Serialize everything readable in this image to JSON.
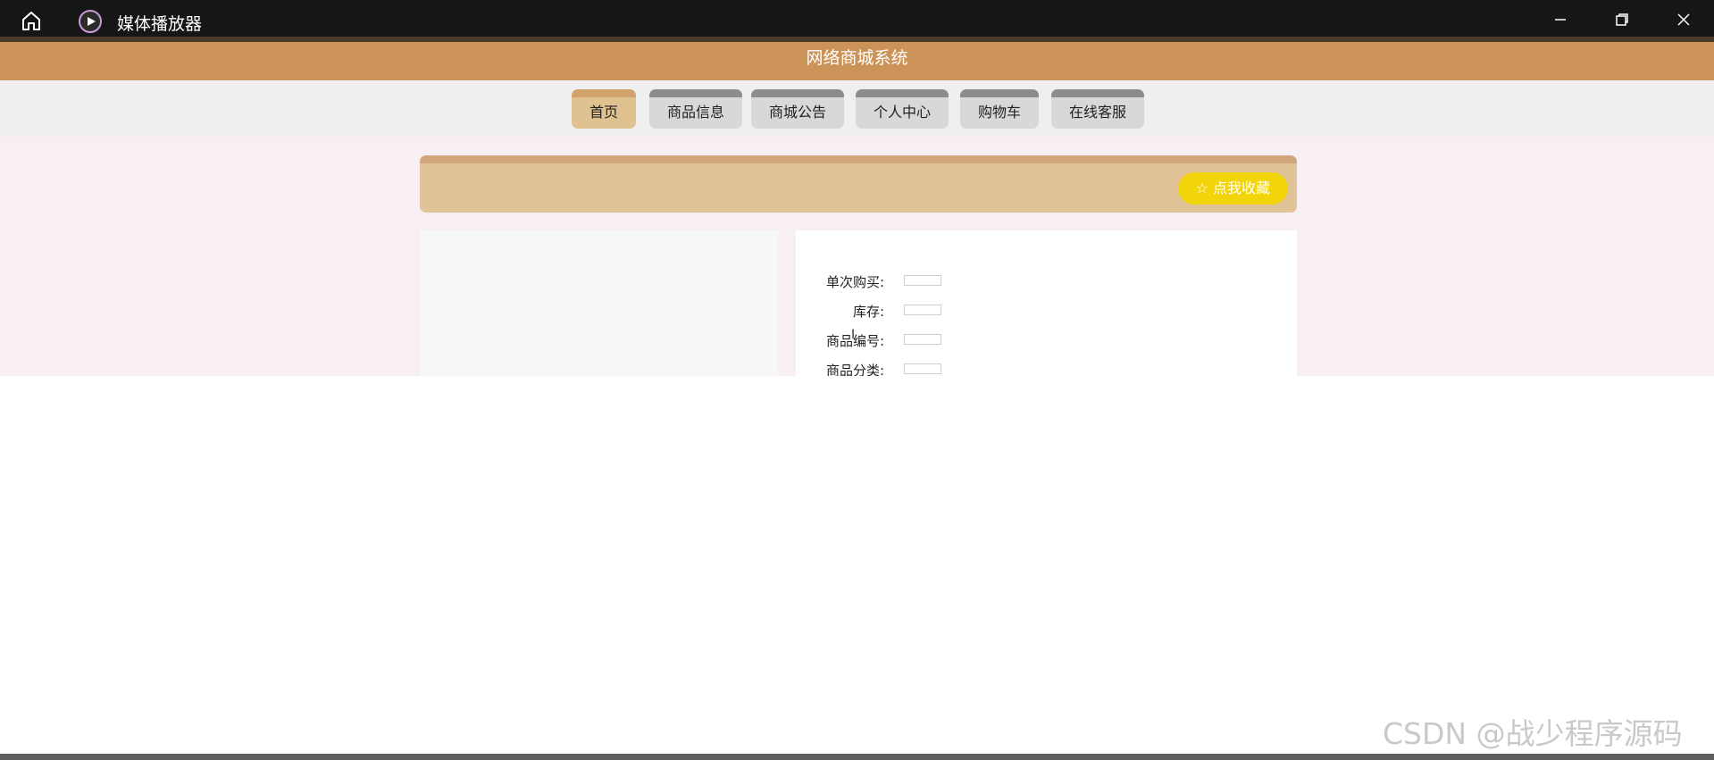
{
  "window": {
    "title": "媒体播放器",
    "icons": {
      "home": "home-icon",
      "app": "play-circle-icon",
      "minimize": "minimize-icon",
      "maximize": "restore-icon",
      "close": "close-icon"
    }
  },
  "site": {
    "title": "网络商城系统"
  },
  "nav": {
    "items": [
      {
        "label": "首页",
        "active": true
      },
      {
        "label": "商品信息",
        "active": false
      },
      {
        "label": "商城公告",
        "active": false
      },
      {
        "label": "个人中心",
        "active": false
      },
      {
        "label": "购物车",
        "active": false
      },
      {
        "label": "在线客服",
        "active": false
      }
    ]
  },
  "banner": {
    "favorite_label": "☆ 点我收藏"
  },
  "product": {
    "fields": [
      {
        "label": "单次购买:",
        "value": ""
      },
      {
        "label": "库存:",
        "value": ""
      },
      {
        "label": "商品编号:",
        "value": ""
      },
      {
        "label": "商品分类:",
        "value": ""
      }
    ]
  },
  "watermark": "CSDN @战少程序源码",
  "colors": {
    "titlebar": "#161616",
    "header": "#cc9359",
    "nav_active": "#e0c290",
    "banner": "#e0c497",
    "favorite_button": "#f2d40a",
    "page_background": "#f7eff3"
  }
}
